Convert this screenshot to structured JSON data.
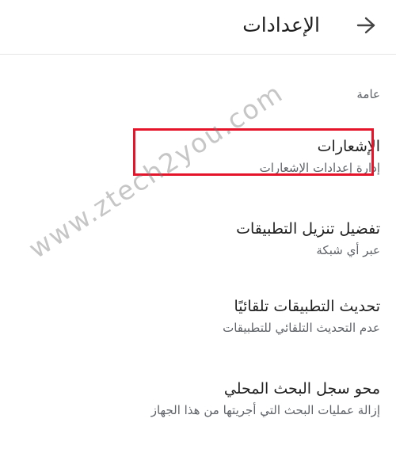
{
  "header": {
    "title": "الإعدادات",
    "back_icon": "arrow-back-icon"
  },
  "section": {
    "header": "عامة"
  },
  "items": [
    {
      "title": "الإشعارات",
      "subtitle": "إدارة إعدادات الإشعارات"
    },
    {
      "title": "تفضيل تنزيل التطبيقات",
      "subtitle": "عبر أي شبكة"
    },
    {
      "title": "تحديث التطبيقات تلقائيًا",
      "subtitle": "عدم التحديث التلقائي للتطبيقات"
    },
    {
      "title": "محو سجل البحث المحلي",
      "subtitle": "إزالة عمليات البحث التي أجريتها من هذا الجهاز"
    }
  ],
  "watermark": "www.ztech2you.com",
  "colors": {
    "highlight": "#e5142b",
    "text_primary": "#202020",
    "text_secondary": "#5f6368",
    "divider": "#e6e6e6"
  }
}
